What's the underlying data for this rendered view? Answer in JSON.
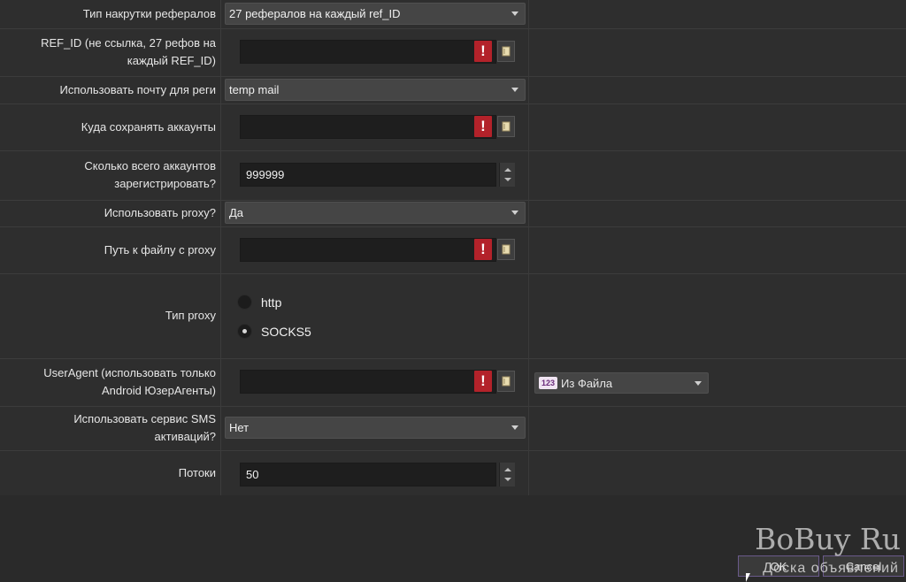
{
  "form": {
    "ref_type": {
      "label": "Тип накрутки рефералов",
      "value": "27 рефералов на каждый ref_ID"
    },
    "ref_id": {
      "label": "REF_ID (не ссылка, 27 рефов на\nкаждый REF_ID)",
      "value": ""
    },
    "mail": {
      "label": "Использовать почту для реги",
      "value": "temp mail"
    },
    "save_path": {
      "label": "Куда сохранять аккаунты",
      "value": ""
    },
    "accounts_count": {
      "label": "Сколько всего аккаунтов\nзарегистрировать?",
      "value": "999999"
    },
    "use_proxy": {
      "label": "Использовать proxy?",
      "value": "Да"
    },
    "proxy_file": {
      "label": "Путь к файлу с proxy",
      "value": ""
    },
    "proxy_type": {
      "label": "Тип proxy",
      "options": [
        "http",
        "SOCKS5"
      ],
      "selected": "SOCKS5"
    },
    "user_agent": {
      "label": "UserAgent (использовать только\nAndroid ЮзерАгенты)",
      "value": "",
      "source_badge": "123",
      "source": "Из Файла"
    },
    "sms": {
      "label": "Использовать сервис SMS\nактиваций?",
      "value": "Нет"
    },
    "threads": {
      "label": "Потоки",
      "value": "50"
    }
  },
  "icons": {
    "warning": "!",
    "folder": "folder-icon"
  },
  "buttons": {
    "ok": "OK",
    "cancel": "Cancel"
  },
  "watermark": {
    "title": "BoBuy Ru",
    "subtitle": "Доска объявлений"
  },
  "colors": {
    "warning": "#b3222a",
    "background": "#2e2e2e",
    "input": "#1e1e1e"
  }
}
